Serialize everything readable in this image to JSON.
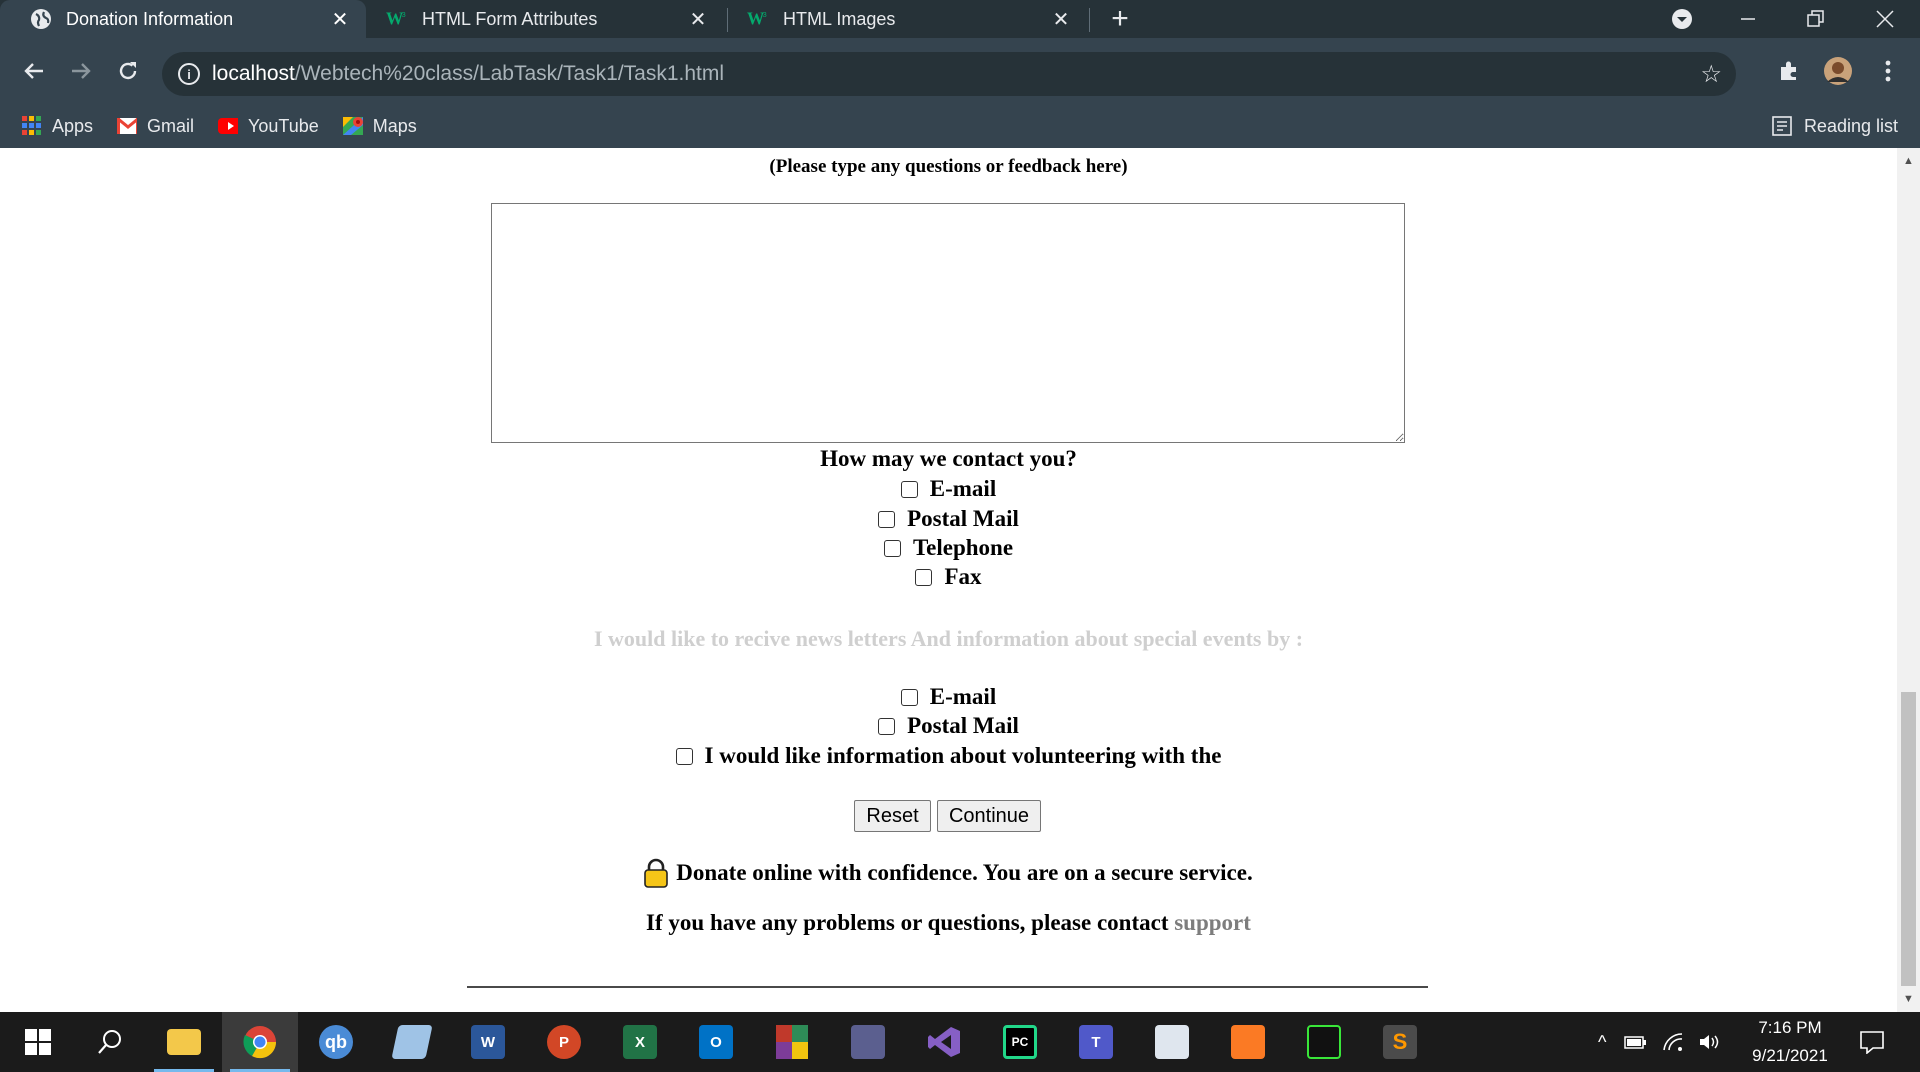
{
  "browser": {
    "tabs": [
      {
        "title": "Donation Information",
        "active": true,
        "favicon": "globe-icon"
      },
      {
        "title": "HTML Form Attributes",
        "active": false,
        "favicon": "w3schools-icon"
      },
      {
        "title": "HTML Images",
        "active": false,
        "favicon": "w3schools-icon"
      }
    ],
    "new_tab": "+",
    "url_host": "localhost",
    "url_path": "/Webtech%20class/LabTask/Task1/Task1.html",
    "bookmarks": [
      {
        "label": "Apps",
        "icon": "apps-grid-icon"
      },
      {
        "label": "Gmail",
        "icon": "gmail-icon"
      },
      {
        "label": "YouTube",
        "icon": "youtube-icon"
      },
      {
        "label": "Maps",
        "icon": "maps-icon"
      }
    ],
    "reading_list": "Reading list",
    "accent": "#35444f",
    "tabbar_color": "#263238"
  },
  "form": {
    "feedback_hint": "(Please type any questions or feedback here)",
    "feedback_value": "",
    "contact_question": "How may we contact you?",
    "contact_options": [
      "E-mail",
      "Postal Mail",
      "Telephone",
      "Fax"
    ],
    "newsletter_text": "I would like to recive news letters And information about special events by :",
    "newsletter_options": [
      "E-mail",
      "Postal Mail"
    ],
    "volunteer_text": "I would like information about volunteering with the",
    "reset_label": "Reset",
    "continue_label": "Continue",
    "secure_text": "Donate online with confidence. You are on a secure service.",
    "problems_text": "If you have any problems or questions, please contact",
    "support_link": "support",
    "newsletter_color": "#cfcfcf",
    "support_color": "#7d7d7d"
  },
  "taskbar": {
    "apps": [
      {
        "name": "file-explorer-icon",
        "label": ""
      },
      {
        "name": "chrome-icon",
        "label": ""
      },
      {
        "name": "qbittorrent-icon",
        "label": "qb"
      },
      {
        "name": "notes-app-icon",
        "label": ""
      },
      {
        "name": "word-icon",
        "label": "W"
      },
      {
        "name": "powerpoint-icon",
        "label": "P"
      },
      {
        "name": "excel-icon",
        "label": "X"
      },
      {
        "name": "outlook-icon",
        "label": "O"
      },
      {
        "name": "winrar-icon",
        "label": ""
      },
      {
        "name": "database-app-icon",
        "label": ""
      },
      {
        "name": "visual-studio-icon",
        "label": ""
      },
      {
        "name": "pycharm-icon",
        "label": "PC"
      },
      {
        "name": "teams-icon",
        "label": "T"
      },
      {
        "name": "remote-desktop-icon",
        "label": ""
      },
      {
        "name": "xampp-icon",
        "label": ""
      },
      {
        "name": "emulator-icon",
        "label": ""
      },
      {
        "name": "sublime-text-icon",
        "label": "S"
      }
    ],
    "time": "7:16 PM",
    "date": "9/21/2021"
  }
}
